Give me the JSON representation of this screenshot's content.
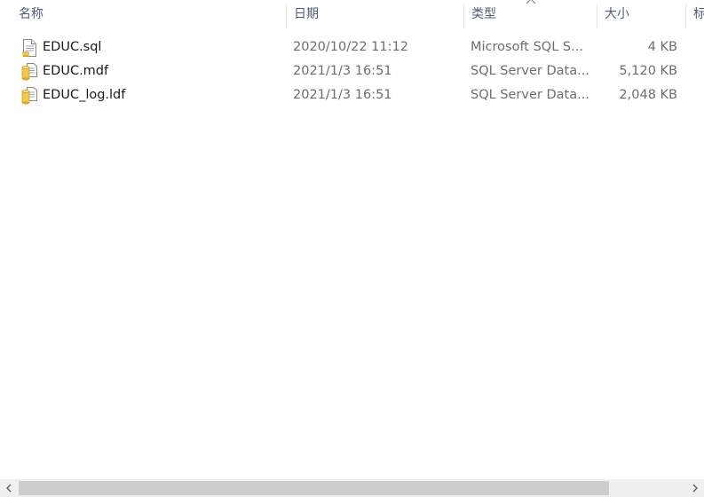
{
  "columns": {
    "name": "名称",
    "date": "日期",
    "type": "类型",
    "size": "大小",
    "tags": "标"
  },
  "sort": {
    "column": "type",
    "icon": "chevron-up-icon"
  },
  "files": [
    {
      "name": "EDUC.sql",
      "date": "2020/10/22 11:12",
      "type": "Microsoft SQL S...",
      "size": "4 KB",
      "icon": "sql-file-icon"
    },
    {
      "name": "EDUC.mdf",
      "date": "2021/1/3 16:51",
      "type": "SQL Server Data...",
      "size": "5,120 KB",
      "icon": "database-file-icon"
    },
    {
      "name": "EDUC_log.ldf",
      "date": "2021/1/3 16:51",
      "type": "SQL Server Data...",
      "size": "2,048 KB",
      "icon": "database-log-file-icon"
    }
  ],
  "scrollbar": {
    "orientation": "horizontal",
    "left_arrow_icon": "chevron-left-icon",
    "right_arrow_icon": "chevron-right-icon"
  }
}
